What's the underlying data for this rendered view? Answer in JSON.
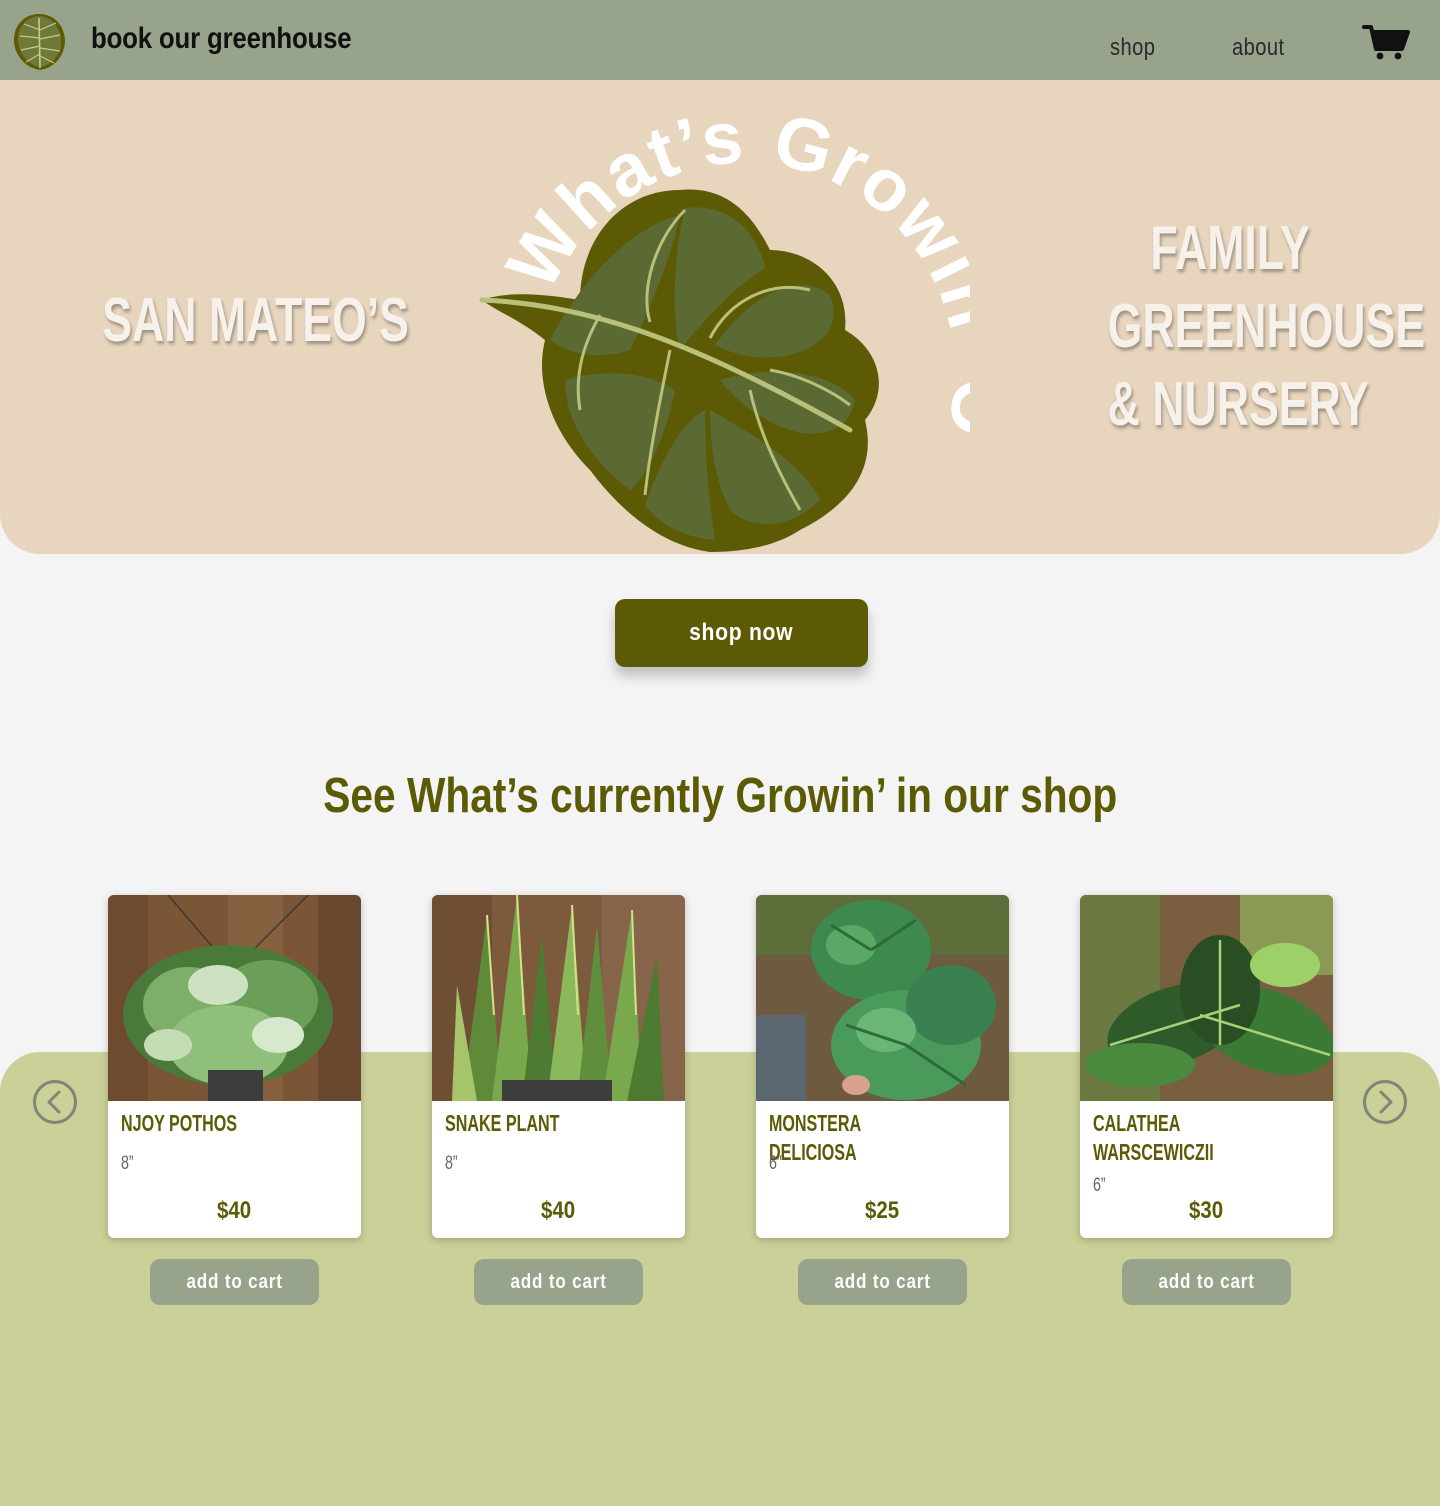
{
  "nav": {
    "brand": "book our greenhouse",
    "links": [
      {
        "label": "shop"
      },
      {
        "label": "about"
      }
    ],
    "logo_icon": "monstera-leaf-icon",
    "cart_icon": "shopping-cart-icon"
  },
  "hero": {
    "left_text": "San Mateo’s",
    "right_text": [
      "Family",
      "Greenhouse",
      "& Nursery"
    ],
    "art_text": "What’s Growin’ On"
  },
  "cta": {
    "label": "shop now"
  },
  "section": {
    "title": "See What’s currently Growin’ in our shop"
  },
  "carousel": {
    "prev_icon": "chevron-left-icon",
    "next_icon": "chevron-right-icon"
  },
  "products": [
    {
      "name": "NJoy Pothos",
      "size": "8”",
      "price": "$40",
      "button": "add to cart"
    },
    {
      "name": "Snake Plant",
      "size": "8”",
      "price": "$40",
      "button": "add to cart"
    },
    {
      "name": "Monstera Deliciosa",
      "size": "6”",
      "price": "$25",
      "button": "add to cart"
    },
    {
      "name": "Calathea Warscewiczii",
      "size": "6”",
      "price": "$30",
      "button": "add to cart"
    }
  ],
  "colors": {
    "nav_bg": "#98a38b",
    "hero_bg": "#e8d5bd",
    "olive": "#5c5a05",
    "products_bg": "#cbd098",
    "page_bg": "#f4f4f4"
  }
}
